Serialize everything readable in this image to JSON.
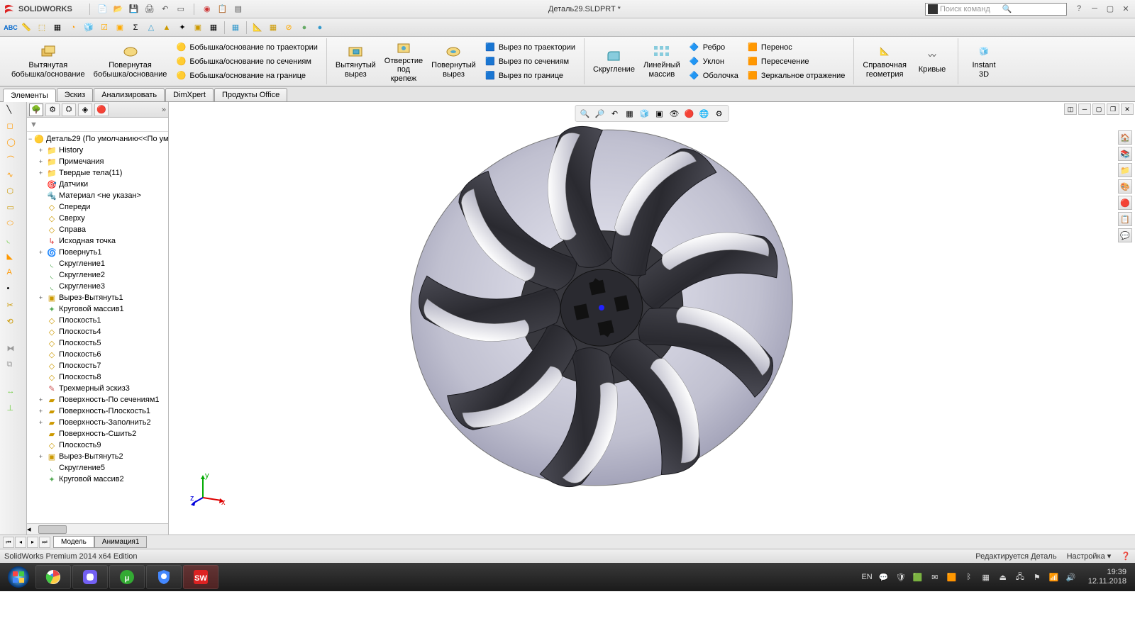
{
  "app": {
    "name": "SOLIDWORKS",
    "doc_title": "Деталь29.SLDPRT *",
    "search_placeholder": "Поиск команд"
  },
  "tabs": {
    "elements": "Элементы",
    "sketch": "Эскиз",
    "analyze": "Анализировать",
    "dimxpert": "DimXpert",
    "office": "Продукты Office"
  },
  "ribbon": {
    "extrude": "Вытянутая\nбобышка/основание",
    "revolve": "Повернутая\nбобышка/основание",
    "sweep": "Бобышка/основание по траектории",
    "loft": "Бобышка/основание по сечениям",
    "boundary": "Бобышка/основание на границе",
    "extrude_cut": "Вытянутый\nвырез",
    "hole": "Отверстие\nпод\nкрепеж",
    "revolve_cut": "Повернутый\nвырез",
    "sweep_cut": "Вырез по траектории",
    "loft_cut": "Вырез по сечениям",
    "boundary_cut": "Вырез по границе",
    "fillet": "Скругление",
    "pattern": "Линейный\nмассив",
    "rib": "Ребро",
    "draft": "Уклон",
    "shell": "Оболочка",
    "move": "Перенос",
    "intersect": "Пересечение",
    "mirror": "Зеркальное отражение",
    "ref_geom": "Справочная\nгеометрия",
    "curves": "Кривые",
    "instant3d": "Instant\n3D"
  },
  "tree": {
    "root": "Деталь29  (По умолчанию<<По ум",
    "items": [
      {
        "icon": "folder",
        "label": "History",
        "expand": "+",
        "indent": 1
      },
      {
        "icon": "folder",
        "label": "Примечания",
        "expand": "+",
        "indent": 1
      },
      {
        "icon": "folder",
        "label": "Твердые тела(11)",
        "expand": "+",
        "indent": 1
      },
      {
        "icon": "sensor",
        "label": "Датчики",
        "expand": "",
        "indent": 1
      },
      {
        "icon": "material",
        "label": "Материал <не указан>",
        "expand": "",
        "indent": 1
      },
      {
        "icon": "plane",
        "label": "Спереди",
        "expand": "",
        "indent": 1
      },
      {
        "icon": "plane",
        "label": "Сверху",
        "expand": "",
        "indent": 1
      },
      {
        "icon": "plane",
        "label": "Справа",
        "expand": "",
        "indent": 1
      },
      {
        "icon": "origin",
        "label": "Исходная точка",
        "expand": "",
        "indent": 1
      },
      {
        "icon": "revolve",
        "label": "Повернуть1",
        "expand": "+",
        "indent": 1
      },
      {
        "icon": "fillet",
        "label": "Скругление1",
        "expand": "",
        "indent": 1
      },
      {
        "icon": "fillet",
        "label": "Скругление2",
        "expand": "",
        "indent": 1
      },
      {
        "icon": "fillet",
        "label": "Скругление3",
        "expand": "",
        "indent": 1
      },
      {
        "icon": "cut",
        "label": "Вырез-Вытянуть1",
        "expand": "+",
        "indent": 1
      },
      {
        "icon": "pattern",
        "label": "Круговой массив1",
        "expand": "",
        "indent": 1
      },
      {
        "icon": "plane",
        "label": "Плоскость1",
        "expand": "",
        "indent": 1
      },
      {
        "icon": "plane",
        "label": "Плоскость4",
        "expand": "",
        "indent": 1
      },
      {
        "icon": "plane",
        "label": "Плоскость5",
        "expand": "",
        "indent": 1
      },
      {
        "icon": "plane",
        "label": "Плоскость6",
        "expand": "",
        "indent": 1
      },
      {
        "icon": "plane",
        "label": "Плоскость7",
        "expand": "",
        "indent": 1
      },
      {
        "icon": "plane",
        "label": "Плоскость8",
        "expand": "",
        "indent": 1
      },
      {
        "icon": "3dsketch",
        "label": "Трехмерный эскиз3",
        "expand": "",
        "indent": 1
      },
      {
        "icon": "surface",
        "label": "Поверхность-По сечениям1",
        "expand": "+",
        "indent": 1
      },
      {
        "icon": "surface",
        "label": "Поверхность-Плоскость1",
        "expand": "+",
        "indent": 1
      },
      {
        "icon": "surface",
        "label": "Поверхность-Заполнить2",
        "expand": "+",
        "indent": 1
      },
      {
        "icon": "surface",
        "label": "Поверхность-Сшить2",
        "expand": "",
        "indent": 1
      },
      {
        "icon": "plane",
        "label": "Плоскость9",
        "expand": "",
        "indent": 1
      },
      {
        "icon": "cut",
        "label": "Вырез-Вытянуть2",
        "expand": "+",
        "indent": 1
      },
      {
        "icon": "fillet",
        "label": "Скругление5",
        "expand": "",
        "indent": 1
      },
      {
        "icon": "pattern",
        "label": "Круговой массив2",
        "expand": "",
        "indent": 1
      }
    ]
  },
  "bottom_tabs": {
    "model": "Модель",
    "animation": "Анимация1"
  },
  "statusbar": {
    "left": "SolidWorks Premium 2014 x64 Edition",
    "editing": "Редактируется Деталь",
    "setting": "Настройка"
  },
  "triad": {
    "x": "x",
    "y": "y",
    "z": "z"
  },
  "taskbar": {
    "lang": "EN",
    "time": "19:39",
    "date": "12.11.2018"
  }
}
